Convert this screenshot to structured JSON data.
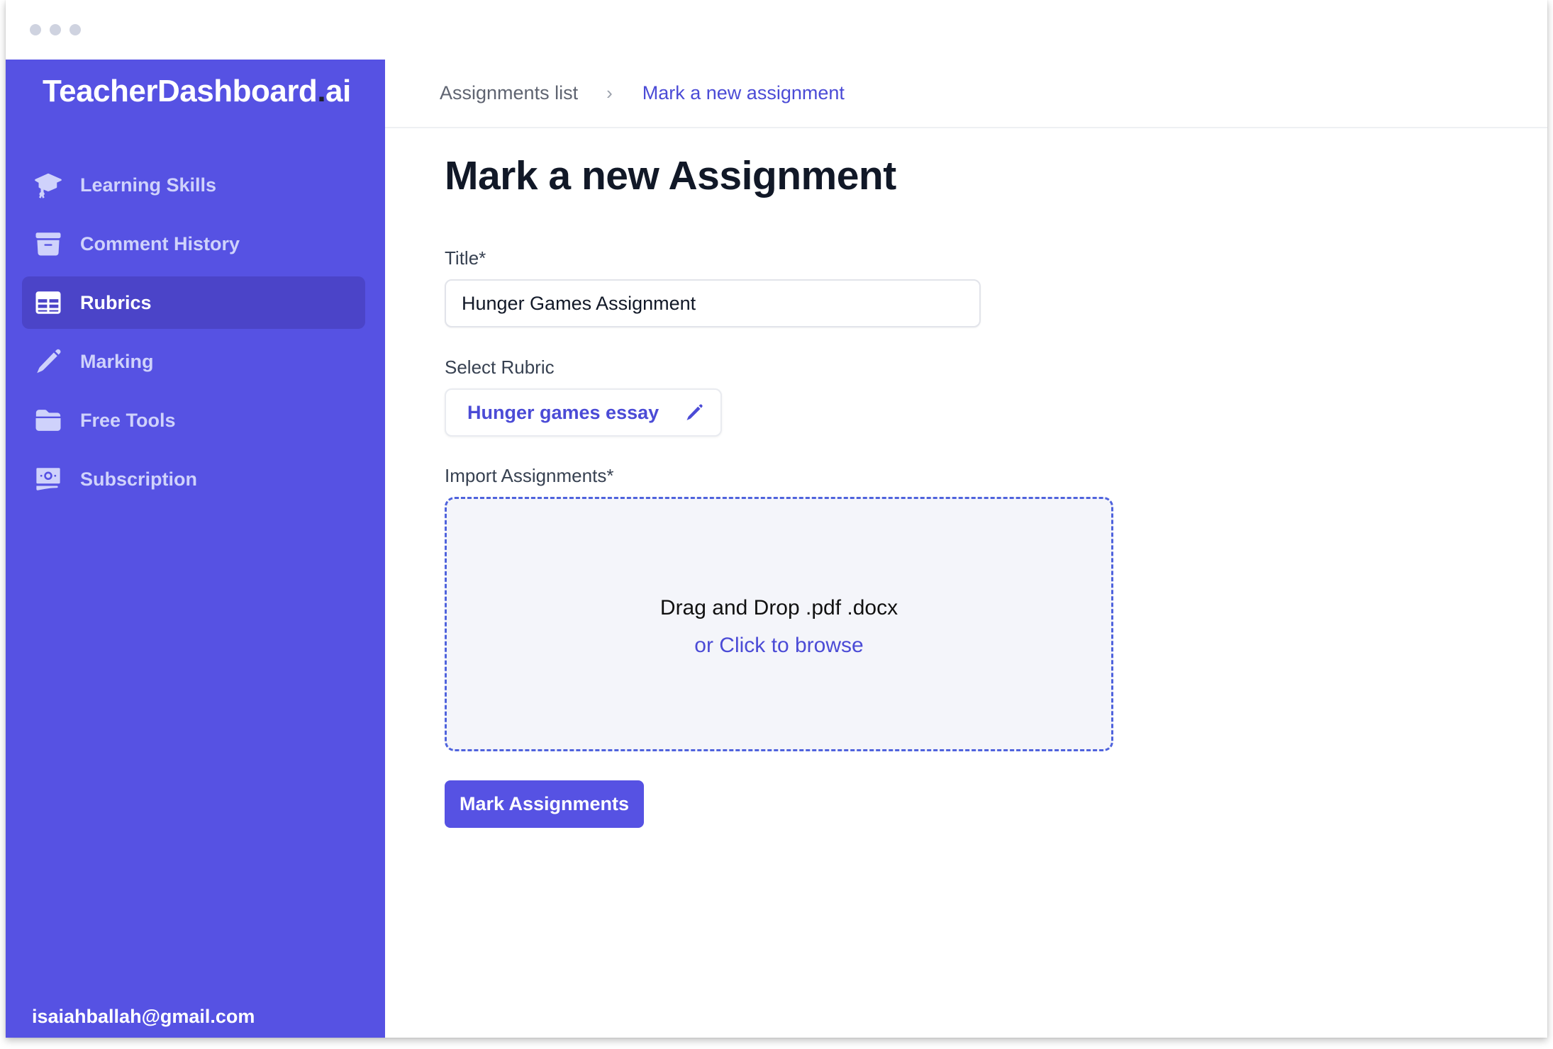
{
  "window": {
    "controls": [
      "close",
      "minimize",
      "maximize"
    ]
  },
  "sidebar": {
    "logo_main": "TeacherDashboard",
    "logo_dot": ".",
    "logo_suffix": "ai",
    "items": [
      {
        "label": "Learning Skills",
        "icon": "graduation-cap-icon",
        "active": false
      },
      {
        "label": "Comment History",
        "icon": "archive-box-icon",
        "active": false
      },
      {
        "label": "Rubrics",
        "icon": "table-icon",
        "active": true
      },
      {
        "label": "Marking",
        "icon": "pencil-icon",
        "active": false
      },
      {
        "label": "Free Tools",
        "icon": "folder-icon",
        "active": false
      },
      {
        "label": "Subscription",
        "icon": "banknotes-icon",
        "active": false
      }
    ],
    "user_email": "isaiahballah@gmail.com"
  },
  "breadcrumb": {
    "items": [
      "Assignments list",
      "Mark a new assignment"
    ],
    "separator": "›"
  },
  "form": {
    "heading": "Mark a new Assignment",
    "title_label": "Title*",
    "title_value": "Hunger Games Assignment",
    "rubric_label": "Select Rubric",
    "rubric_value": "Hunger games essay",
    "import_label": "Import Assignments*",
    "dropzone_text": "Drag and Drop .pdf .docx",
    "dropzone_browse": "or Click to browse",
    "submit_label": "Mark Assignments"
  },
  "colors": {
    "sidebar_bg": "#5652e3",
    "active_item_bg": "#4b44c8",
    "accent_text": "#4b4bd6",
    "button_bg": "#5652e3",
    "dropzone_border": "#4f63dd",
    "dropzone_bg": "#f4f5fa"
  }
}
